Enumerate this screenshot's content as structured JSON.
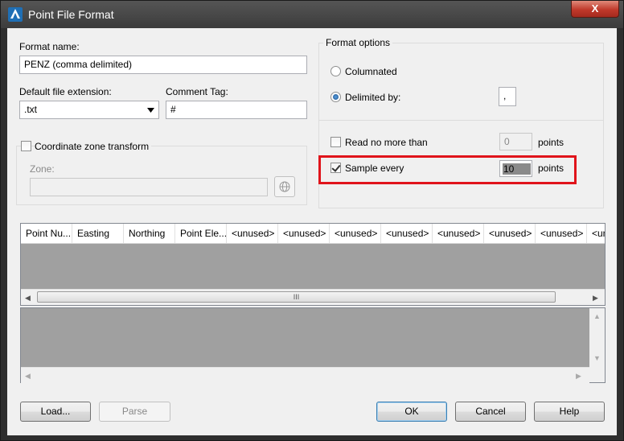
{
  "window": {
    "title": "Point File Format",
    "close_label": "X"
  },
  "format_name": {
    "label": "Format name:",
    "value": "PENZ (comma delimited)"
  },
  "default_ext": {
    "label": "Default file extension:",
    "value": ".txt"
  },
  "comment_tag": {
    "label": "Comment Tag:",
    "value": "#"
  },
  "coord_zone": {
    "label": "Coordinate zone transform",
    "checked": false
  },
  "zone": {
    "label": "Zone:",
    "value": ""
  },
  "format_options": {
    "title": "Format options",
    "columnated_label": "Columnated",
    "delimited_label": "Delimited by:",
    "delimiter_value": ",",
    "read_no_more_label": "Read no more than",
    "read_no_more_value": "0",
    "read_no_more_unit": "points",
    "sample_every_label": "Sample every",
    "sample_every_value": "10",
    "sample_every_unit": "points"
  },
  "grid": {
    "columns": [
      "Point Nu...",
      "Easting",
      "Northing",
      "Point Ele...",
      "<unused>",
      "<unused>",
      "<unused>",
      "<unused>",
      "<unused>",
      "<unused>",
      "<unused>",
      "<un"
    ],
    "scroll_thumb_glyph": "III"
  },
  "buttons": {
    "load": "Load...",
    "parse": "Parse",
    "ok": "OK",
    "cancel": "Cancel",
    "help": "Help"
  },
  "colors": {
    "highlight": "#e0141b",
    "title_bar": "#3c3c3c",
    "close": "#c0392b"
  }
}
